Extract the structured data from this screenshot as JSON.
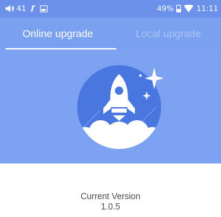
{
  "status_bar": {
    "volume_level": "41",
    "battery_percent": "49%",
    "time": "11:11",
    "icons": [
      "volume-icon",
      "nfc-icon",
      "gallery-icon",
      "battery-icon",
      "wifi-icon"
    ]
  },
  "tabs": [
    {
      "label": "Online upgrade",
      "active": true
    },
    {
      "label": "Local upgrade",
      "active": false
    }
  ],
  "hero": {
    "icon": "rocket-icon"
  },
  "version": {
    "label": "Current Version",
    "number": "1.0.5"
  },
  "colors": {
    "accent": "#7ca1f0",
    "status_bar": "#6b91ea",
    "circle": "#4a76e0",
    "text": "#4d4d4d"
  }
}
